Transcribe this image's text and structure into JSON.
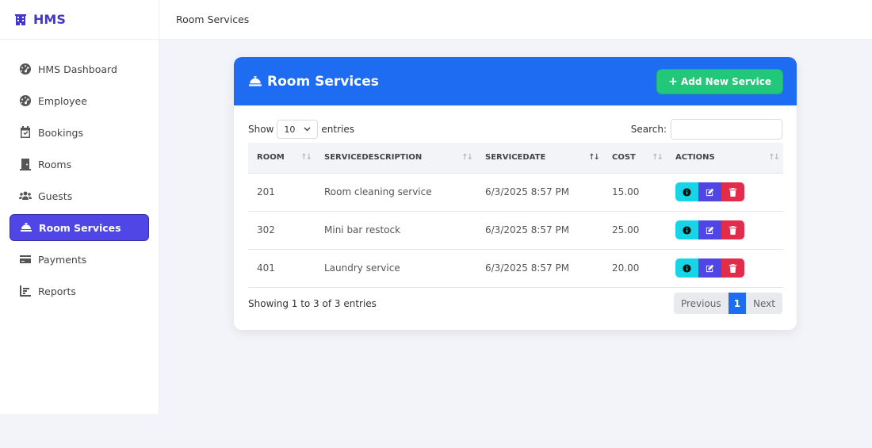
{
  "brand": {
    "name": "HMS"
  },
  "sidebar": {
    "items": [
      {
        "label": "HMS Dashboard",
        "icon": "dashboard-icon",
        "active": false
      },
      {
        "label": "Employee",
        "icon": "dashboard-icon",
        "active": false
      },
      {
        "label": "Bookings",
        "icon": "calendar-check-icon",
        "active": false
      },
      {
        "label": "Rooms",
        "icon": "door-icon",
        "active": false
      },
      {
        "label": "Guests",
        "icon": "users-icon",
        "active": false
      },
      {
        "label": "Room Services",
        "icon": "bell-concierge-icon",
        "active": true
      },
      {
        "label": "Payments",
        "icon": "credit-card-icon",
        "active": false
      },
      {
        "label": "Reports",
        "icon": "chart-icon",
        "active": false
      }
    ]
  },
  "topbar": {
    "breadcrumb": "Room Services"
  },
  "card": {
    "title": "Room Services",
    "add_button": "Add New Service"
  },
  "controls": {
    "show_label": "Show",
    "entries_value": "10",
    "entries_label": "entries",
    "search_label": "Search:",
    "search_value": ""
  },
  "table": {
    "columns": [
      "ROOM",
      "SERVICEDESCRIPTION",
      "SERVICEDATE",
      "COST",
      "ACTIONS"
    ],
    "rows": [
      [
        "201",
        "Room cleaning service",
        "6/3/2025 8:57 PM",
        "15.00"
      ],
      [
        "302",
        "Mini bar restock",
        "6/3/2025 8:57 PM",
        "25.00"
      ],
      [
        "401",
        "Laundry service",
        "6/3/2025 8:57 PM",
        "20.00"
      ]
    ]
  },
  "footer": {
    "info": "Showing 1 to 3 of 3 entries",
    "prev": "Previous",
    "page": "1",
    "next": "Next"
  },
  "colors": {
    "primary": "#1d6cf2",
    "accent": "#4f46e5",
    "success": "#22c77a",
    "info": "#19d3e6",
    "danger": "#e12d4b"
  }
}
